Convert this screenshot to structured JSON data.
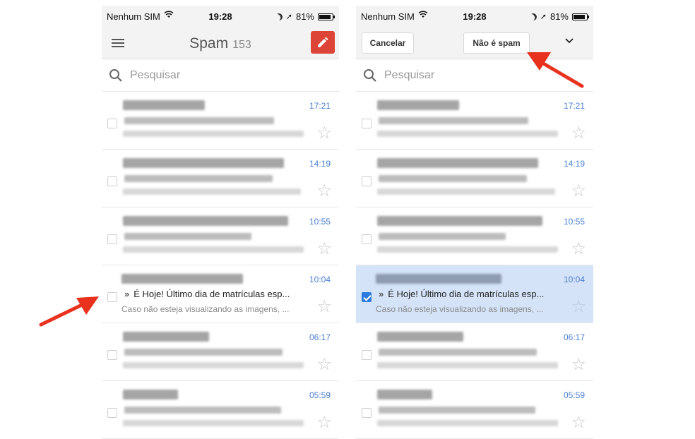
{
  "status_bar": {
    "carrier": "Nenhum SIM",
    "time": "19:28",
    "battery": "81%"
  },
  "left_screen": {
    "title": "Spam",
    "count": "153",
    "search_placeholder": "Pesquisar",
    "rows": [
      {
        "time": "17:21"
      },
      {
        "time": "14:19"
      },
      {
        "time": "10:55"
      },
      {
        "time": "10:04",
        "subject": "É Hoje! Último dia de matrículas esp...",
        "snippet": "Caso não esteja visualizando as imagens, ..."
      },
      {
        "time": "06:17"
      },
      {
        "time": "05:59"
      }
    ]
  },
  "right_screen": {
    "cancel_label": "Cancelar",
    "not_spam_label": "Não é spam",
    "search_placeholder": "Pesquisar",
    "rows": [
      {
        "time": "17:21"
      },
      {
        "time": "14:19"
      },
      {
        "time": "10:55"
      },
      {
        "time": "10:04",
        "subject": "É Hoje! Último dia de matrículas esp...",
        "snippet": "Caso não esteja visualizando as imagens, ...",
        "selected": true
      },
      {
        "time": "06:17"
      },
      {
        "time": "05:59"
      }
    ]
  },
  "colors": {
    "accent": "#db4437",
    "time_blue": "#4a7fd1",
    "selected_bg": "#d5e3f8",
    "arrow": "#e8321e"
  }
}
